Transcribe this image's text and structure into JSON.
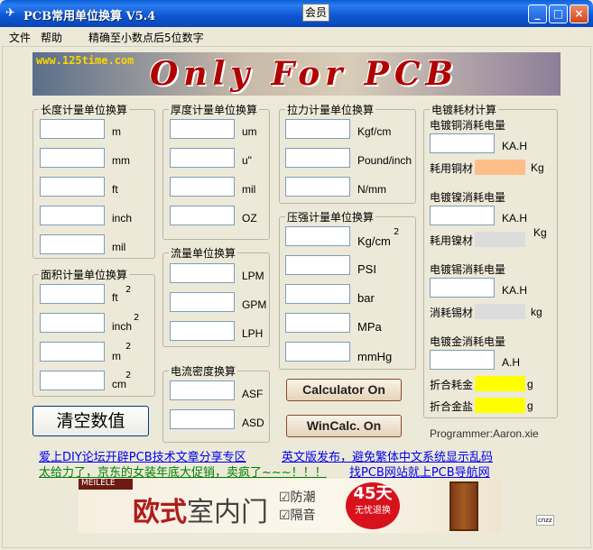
{
  "titlebar": {
    "title": "PCB常用单位换算 V5.4",
    "member_button": "会员",
    "minimize": "_",
    "maximize": "□",
    "close": "×"
  },
  "menu": {
    "file": "文件",
    "help": "帮助",
    "precision_note": "精确至小数点后5位数字"
  },
  "banner": {
    "site": "www.125time.com",
    "slogan": "Only For PCB"
  },
  "length": {
    "title": "长度计量单位换算",
    "units": [
      "m",
      "mm",
      "ft",
      "inch",
      "mil"
    ]
  },
  "area": {
    "title": "面积计量单位换算",
    "units": [
      "ft",
      "inch",
      "m",
      "cm"
    ],
    "exponent": "2"
  },
  "thickness": {
    "title": "厚度计量单位换算",
    "units": [
      "um",
      "u\"",
      "mil",
      "OZ"
    ]
  },
  "flow": {
    "title": "流量单位换算",
    "units": [
      "LPM",
      "GPM",
      "LPH"
    ]
  },
  "current_density": {
    "title": "电流密度换算",
    "units": [
      "ASF",
      "ASD"
    ]
  },
  "tension": {
    "title": "拉力计量单位换算",
    "units": [
      "Kgf/cm",
      "Pound/inch",
      "N/mm"
    ]
  },
  "pressure": {
    "title": "压强计量单位换算",
    "units": [
      "Kg/cm",
      "PSI",
      "bar",
      "MPa",
      "mmHg"
    ],
    "exponent": "2"
  },
  "plating": {
    "title": "电镀耗材计算",
    "copper_label": "电镀铜消耗电量",
    "copper_unit": "KA.H",
    "copper_material": "耗用铜材",
    "copper_material_unit": "Kg",
    "copper_color": "#fdbf87",
    "nickel_label": "电镀镍消耗电量",
    "nickel_unit": "KA.H",
    "nickel_material": "耗用镍材",
    "nickel_material_unit": "Kg",
    "nickel_color": "#dcdcdc",
    "tin_label": "电镀锡消耗电量",
    "tin_unit": "KA.H",
    "tin_material": "消耗锡材",
    "tin_material_unit": "kg",
    "tin_color": "#dcdcdc",
    "gold_label": "电镀金消耗电量",
    "gold_unit": "A.H",
    "gold_consumption": "折合耗金",
    "gold_consumption_unit": "g",
    "gold_salt": "折合金盐",
    "gold_salt_unit": "g",
    "gold_color": "#ffff00"
  },
  "buttons": {
    "clear": "清空数值",
    "calculator": "Calculator On",
    "wincalc": "WinCalc. On"
  },
  "programmer": "Programmer:Aaron.xie",
  "links": {
    "forum": "爱上DIY论坛开辟PCB技术文章分享专区",
    "english": "英文版发布，避免繁体中文系统显示乱码",
    "promo": "太给力了，京东的女装年底大促销，卖疯了~~~！！！",
    "nav": "找PCB网站就上PCB导航网"
  },
  "ad": {
    "brand": "MEILELE",
    "headline_a": "欧式",
    "headline_b": "室内门",
    "feature_1": "☑防潮",
    "feature_2": "☑隔音",
    "badge_big": "45天",
    "badge_small": "无忧退换",
    "corner": "cnzz"
  }
}
